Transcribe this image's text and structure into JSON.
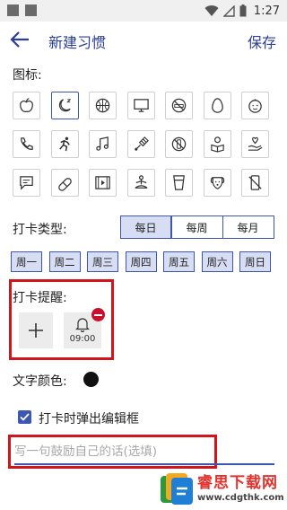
{
  "status_bar": {
    "time": "1:27"
  },
  "header": {
    "title": "新建习惯",
    "save_label": "保存"
  },
  "icons_section": {
    "label": "图标:",
    "icons": [
      "apple-icon",
      "moon-sleep-icon",
      "basketball-icon",
      "tv-icon",
      "no-smoking-icon",
      "egg-icon",
      "baby-face-icon",
      "phone-icon",
      "running-icon",
      "music-note-icon",
      "badminton-icon",
      "no-drinking-icon",
      "reading-icon",
      "heart-hand-icon",
      "chat-icon",
      "pill-icon",
      "video-icon",
      "meditation-icon",
      "water-cup-icon",
      "dog-icon",
      "no-phone-icon"
    ],
    "selected_index": 1
  },
  "checkin_type": {
    "label": "打卡类型:",
    "options": [
      "每日",
      "每周",
      "每月"
    ],
    "selected": "每日"
  },
  "weekdays": [
    "周一",
    "周二",
    "周三",
    "周四",
    "周五",
    "周六",
    "周日"
  ],
  "reminder": {
    "label": "打卡提醒:",
    "times": [
      "09:00"
    ]
  },
  "text_color": {
    "label": "文字颜色:",
    "value": "#111111"
  },
  "popup_editor": {
    "label": "打卡时弹出编辑框",
    "checked": true
  },
  "motto_input": {
    "placeholder": "写一句鼓励自己的话(选填)",
    "value": ""
  },
  "watermark": {
    "title": "睿思下载网",
    "url": "www.cdgthk.com"
  },
  "colors": {
    "accent": "#3d56b2",
    "accent_light": "#d7def4",
    "highlight_box": "#d4141b",
    "remove": "#c8102e"
  }
}
